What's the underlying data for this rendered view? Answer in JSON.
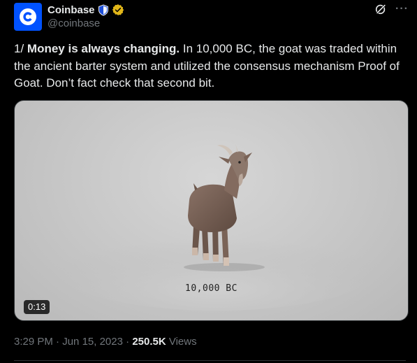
{
  "author": {
    "name": "Coinbase",
    "handle": "@coinbase",
    "avatar_icon": "coinbase-logo",
    "badges": [
      "shield-icon",
      "verified-badge-icon"
    ],
    "brand_color": "#0052ff",
    "verified_color": "#e2b719"
  },
  "actions": {
    "grok_icon": "grok-icon",
    "more_label": "···"
  },
  "tweet": {
    "prefix": "1/ ",
    "bold": "Money is always changing.",
    "rest": " In 10,000 BC, the goat was traded within the ancient barter system and utilized the consensus mechanism Proof of Goat. Don’t fact check that second bit."
  },
  "media": {
    "type": "video",
    "caption": "10,000 BC",
    "duration": "0:13",
    "subject": "goat"
  },
  "meta": {
    "time": "3:29 PM",
    "separator": " · ",
    "date": "Jun 15, 2023",
    "views_count": "250.5K",
    "views_label": " Views"
  }
}
